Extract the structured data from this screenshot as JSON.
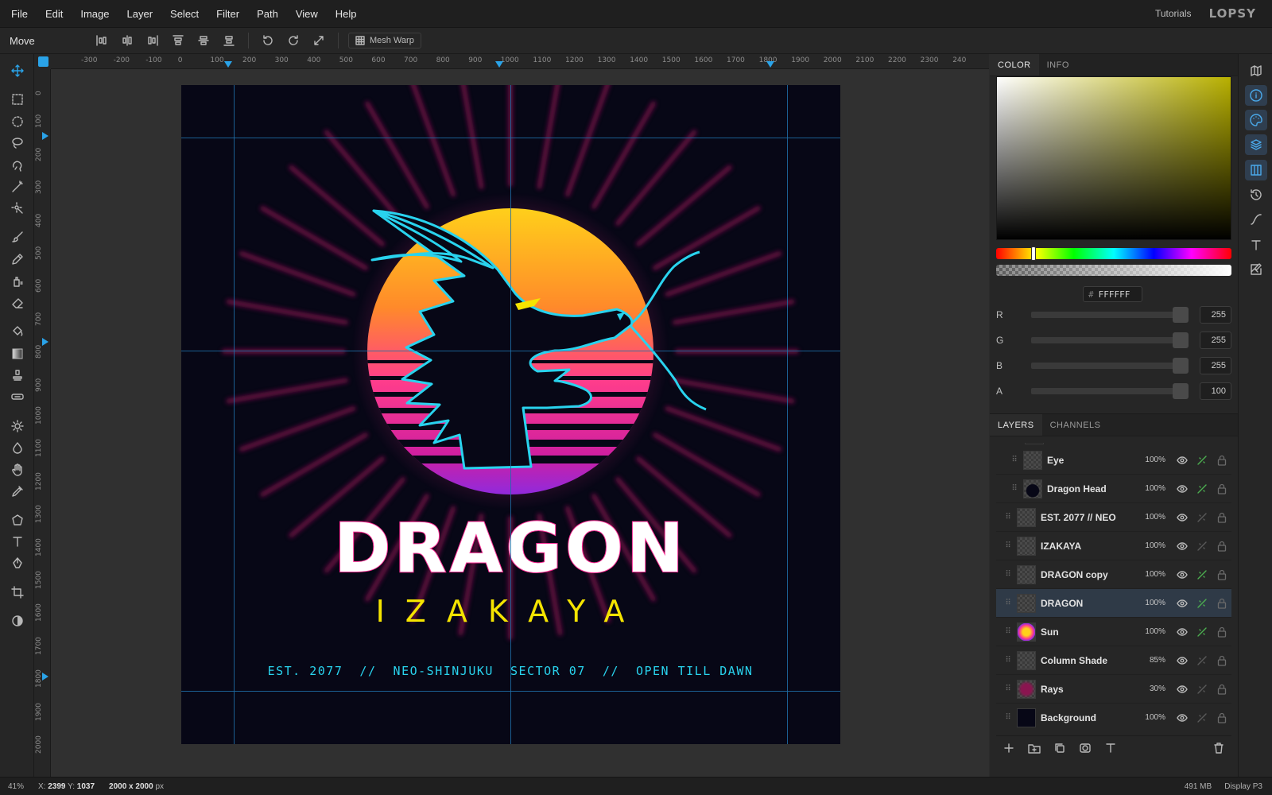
{
  "menu": {
    "items": [
      "File",
      "Edit",
      "Image",
      "Layer",
      "Select",
      "Filter",
      "Path",
      "View",
      "Help"
    ],
    "tutorials": "Tutorials",
    "logo": "LOPSY"
  },
  "options_bar": {
    "tool_name": "Move",
    "mesh_warp_label": "Mesh Warp",
    "align_icons": [
      "align-left-icon",
      "align-center-h-icon",
      "align-right-icon",
      "align-top-icon",
      "align-center-v-icon",
      "align-bottom-icon"
    ],
    "action_icons": [
      "rotate-ccw-icon",
      "rotate-cw-icon",
      "expand-icon"
    ]
  },
  "toolbar": {
    "tools": [
      "move-icon",
      "rect-select-icon",
      "ellipse-select-icon",
      "lasso-icon",
      "magnetic-lasso-icon",
      "magic-wand-icon",
      "quick-select-icon",
      "brush-icon",
      "pencil-icon",
      "clone-icon",
      "eraser-icon",
      "bucket-icon",
      "gradient-icon",
      "stamp-icon",
      "healing-icon",
      "dodge-icon",
      "blur-icon",
      "hand-icon",
      "eyedropper-icon",
      "shape-icon",
      "text-icon",
      "pen-icon",
      "crop-icon",
      "contrast-icon"
    ],
    "active": "move-icon"
  },
  "rulers": {
    "horizontal": [
      "-300",
      "-200",
      "-100",
      "0",
      "100",
      "200",
      "300",
      "400",
      "500",
      "600",
      "700",
      "800",
      "900",
      "1000",
      "1100",
      "1200",
      "1300",
      "1400",
      "1500",
      "1600",
      "1700",
      "1800",
      "1900",
      "2000",
      "2100",
      "2200",
      "2300",
      "240"
    ],
    "vertical": [
      "0",
      "100",
      "200",
      "300",
      "400",
      "500",
      "600",
      "700",
      "800",
      "900",
      "1000",
      "1100",
      "1200",
      "1300",
      "1400",
      "1500",
      "1600",
      "1700",
      "1800",
      "1900",
      "2000"
    ]
  },
  "artwork": {
    "title": "DRAGON",
    "subtitle": "IZAKAYA",
    "tagline": "EST. 2077  //  NEO-SHINJUKU  SECTOR 07  //  OPEN TILL DAWN",
    "colors": {
      "background": "#070716",
      "neon_cyan": "#29d3ee",
      "neon_pink": "#ff2d95",
      "sun_top": "#ffd21a",
      "sun_mid": "#ff3d8b",
      "sun_bottom": "#8a2be2",
      "subtitle_yellow": "#f5e400",
      "ray": "#8a1550"
    }
  },
  "color_panel": {
    "tabs": [
      "COLOR",
      "INFO"
    ],
    "hex": "FFFFFF",
    "channels": [
      {
        "label": "R",
        "value": "255"
      },
      {
        "label": "G",
        "value": "255"
      },
      {
        "label": "B",
        "value": "255"
      },
      {
        "label": "A",
        "value": "100"
      }
    ],
    "hue_position": 0.16
  },
  "layers_panel": {
    "tabs": [
      "LAYERS",
      "CHANNELS"
    ],
    "layers": [
      {
        "name": "Eye",
        "opacity": "100%",
        "indent": true,
        "fx": true
      },
      {
        "name": "Dragon Head",
        "opacity": "100%",
        "indent": true,
        "fx": true
      },
      {
        "name": "EST. 2077 // NEO",
        "opacity": "100%",
        "indent": false,
        "fx": false
      },
      {
        "name": "IZAKAYA",
        "opacity": "100%",
        "indent": false,
        "fx": false
      },
      {
        "name": "DRAGON copy",
        "opacity": "100%",
        "indent": false,
        "fx": true
      },
      {
        "name": "DRAGON",
        "opacity": "100%",
        "indent": false,
        "fx": true,
        "selected": true
      },
      {
        "name": "Sun",
        "opacity": "100%",
        "indent": false,
        "fx": true
      },
      {
        "name": "Column Shade",
        "opacity": "85%",
        "indent": false,
        "fx": false
      },
      {
        "name": "Rays",
        "opacity": "30%",
        "indent": false,
        "fx": false
      },
      {
        "name": "Background",
        "opacity": "100%",
        "indent": false,
        "fx": false
      }
    ]
  },
  "dock": [
    "map-icon",
    "info-icon",
    "palette-icon",
    "layers-icon",
    "columns-icon",
    "history-icon",
    "curve-icon",
    "text-icon",
    "image-edit-icon"
  ],
  "status": {
    "zoom": "41%",
    "x_label": "X:",
    "x": "2399",
    "y_label": "Y:",
    "y": "1037",
    "dims": "2000 x 2000",
    "dims_unit": "px",
    "memory": "491 MB",
    "color_profile": "Display P3"
  }
}
